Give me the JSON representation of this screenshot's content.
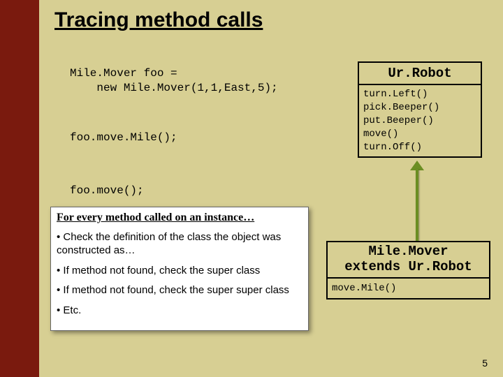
{
  "title": "Tracing method calls",
  "code": {
    "decl": "Mile.Mover foo =\n    new Mile.Mover(1,1,East,5);",
    "call1": "foo.move.Mile();",
    "call2": "foo.move();"
  },
  "urRobot": {
    "title": "Ur.Robot",
    "methods": "turn.Left()\npick.Beeper()\nput.Beeper()\nmove()\nturn.Off()"
  },
  "mileMover": {
    "title_line1": "Mile.Mover",
    "title_line2": "extends Ur.Robot",
    "methods": "move.Mile()"
  },
  "explain": {
    "header": "For every method called on an instance…",
    "b1": "• Check the definition of the class the object was constructed as…",
    "b2": "• If method not found, check the super class",
    "b3": "• If method not found, check the super super class",
    "b4": "• Etc."
  },
  "pageNumber": "5"
}
